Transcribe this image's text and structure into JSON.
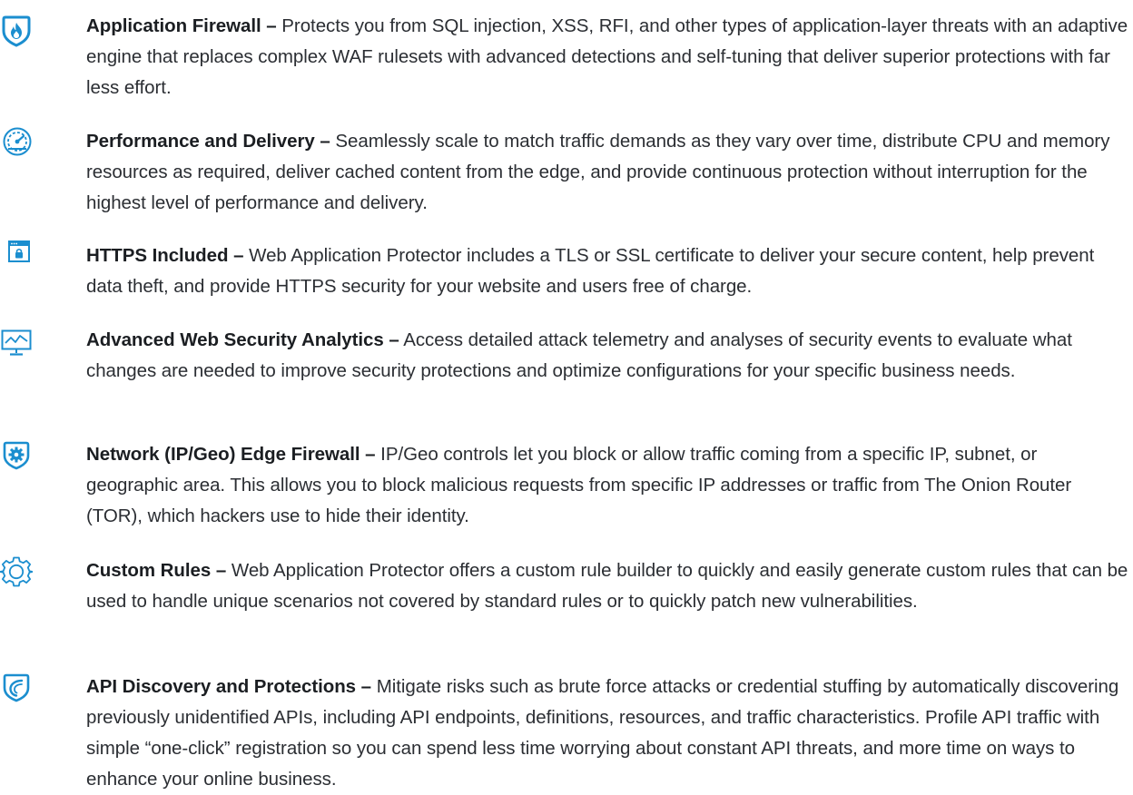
{
  "features": [
    {
      "icon": "flame-shield-icon",
      "title": "Application Firewall –",
      "text": "Protects you from SQL injection, XSS, RFI, and other types of application-layer threats with an adaptive engine that replaces complex WAF rulesets with advanced detections and self-tuning that deliver superior protections with far less effort."
    },
    {
      "icon": "speedometer-icon",
      "title": "Performance and Delivery –",
      "text": "Seamlessly scale to match traffic demands as they vary over time, distribute CPU and memory resources as required, deliver cached content from the edge, and provide continuous protection without interruption for the highest level of performance and delivery."
    },
    {
      "icon": "browser-lock-icon",
      "title": "HTTPS Included –",
      "text": "Web Application Protector includes a TLS or SSL certificate to deliver your secure content, help prevent data theft, and provide HTTPS security for your website and users free of charge."
    },
    {
      "icon": "monitor-chart-icon",
      "title": "Advanced Web Security Analytics –",
      "text": "Access detailed attack telemetry and analyses of security events to evaluate what changes are needed to improve security protections and optimize configurations for your specific business needs."
    },
    {
      "icon": "gear-shield-icon",
      "title": "Network (IP/Geo) Edge Firewall –",
      "text": "IP/Geo controls let you block or allow traffic coming from a specific IP, subnet, or geographic area. This allows you to block malicious requests from specific IP addresses or traffic from The Onion Router (TOR), which hackers use to hide their identity."
    },
    {
      "icon": "gear-icon",
      "title": "Custom Rules –",
      "text": "Web Application Protector offers a custom rule builder to quickly and easily generate custom rules that can be used to handle unique scenarios not covered by standard rules or to quickly patch new vulnerabilities."
    },
    {
      "icon": "api-shield-icon",
      "title": "API Discovery and Protections –",
      "text": "Mitigate risks such as brute force attacks or credential stuffing by automatically discovering previously unidentified APIs, including API endpoints, definitions, resources, and traffic characteristics. Profile API traffic with simple “one-click” registration so you can spend less time worrying about constant API threats, and more time on ways to enhance your online business."
    }
  ],
  "colors": {
    "icon": "#1b8ecf",
    "text": "#2b2e33",
    "title": "#1b1e22"
  }
}
